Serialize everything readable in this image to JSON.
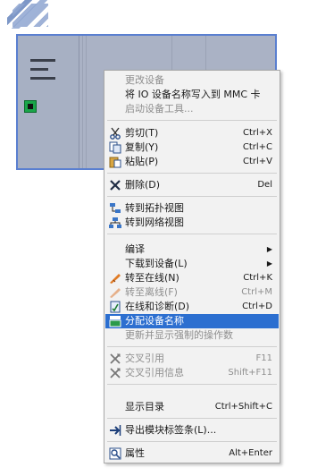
{
  "menu": {
    "items": [
      {
        "label": "更改设备",
        "shortcut": "",
        "icon": "",
        "enabled": false,
        "selected": false,
        "submenu": false
      },
      {
        "label": "将 IO 设备名称写入到 MMC 卡",
        "shortcut": "",
        "icon": "",
        "enabled": true,
        "selected": false,
        "submenu": false
      },
      {
        "label": "启动设备工具...",
        "shortcut": "",
        "icon": "",
        "enabled": false,
        "selected": false,
        "submenu": false
      },
      {
        "label": "剪切(T)",
        "shortcut": "Ctrl+X",
        "icon": "scissors-icon",
        "enabled": true,
        "selected": false,
        "submenu": false
      },
      {
        "label": "复制(Y)",
        "shortcut": "Ctrl+C",
        "icon": "copy-icon",
        "enabled": true,
        "selected": false,
        "submenu": false
      },
      {
        "label": "粘贴(P)",
        "shortcut": "Ctrl+V",
        "icon": "paste-icon",
        "enabled": true,
        "selected": false,
        "submenu": false
      },
      {
        "label": "删除(D)",
        "shortcut": "Del",
        "icon": "delete-x-icon",
        "enabled": true,
        "selected": false,
        "submenu": false
      },
      {
        "label": "转到拓扑视图",
        "shortcut": "",
        "icon": "topology-view-icon",
        "enabled": true,
        "selected": false,
        "submenu": false
      },
      {
        "label": "转到网络视图",
        "shortcut": "",
        "icon": "network-view-icon",
        "enabled": true,
        "selected": false,
        "submenu": false
      },
      {
        "label": "编译",
        "shortcut": "",
        "icon": "",
        "enabled": true,
        "selected": false,
        "submenu": true
      },
      {
        "label": "下载到设备(L)",
        "shortcut": "",
        "icon": "",
        "enabled": true,
        "selected": false,
        "submenu": true
      },
      {
        "label": "转至在线(N)",
        "shortcut": "Ctrl+K",
        "icon": "go-online-icon",
        "enabled": true,
        "selected": false,
        "submenu": false
      },
      {
        "label": "转至离线(F)",
        "shortcut": "Ctrl+M",
        "icon": "go-offline-icon",
        "enabled": false,
        "selected": false,
        "submenu": false
      },
      {
        "label": "在线和诊断(D)",
        "shortcut": "Ctrl+D",
        "icon": "diagnostics-icon",
        "enabled": true,
        "selected": false,
        "submenu": false
      },
      {
        "label": "分配设备名称",
        "shortcut": "",
        "icon": "assign-name-icon",
        "enabled": true,
        "selected": true,
        "submenu": false
      },
      {
        "label": "更新并显示强制的操作数",
        "shortcut": "",
        "icon": "",
        "enabled": false,
        "selected": false,
        "submenu": false
      },
      {
        "label": "交叉引用",
        "shortcut": "F11",
        "icon": "cross-reference-icon",
        "enabled": false,
        "selected": false,
        "submenu": false
      },
      {
        "label": "交叉引用信息",
        "shortcut": "Shift+F11",
        "icon": "cross-reference-info-icon",
        "enabled": false,
        "selected": false,
        "submenu": false
      },
      {
        "label": "显示目录",
        "shortcut": "Ctrl+Shift+C",
        "icon": "",
        "enabled": true,
        "selected": false,
        "submenu": false
      },
      {
        "label": "导出模块标签条(L)...",
        "shortcut": "",
        "icon": "export-arrow-icon",
        "enabled": true,
        "selected": false,
        "submenu": false
      },
      {
        "label": "属性",
        "shortcut": "Alt+Enter",
        "icon": "properties-icon",
        "enabled": true,
        "selected": false,
        "submenu": false
      }
    ]
  },
  "colors": {
    "selection": "#2c6fd0",
    "device_border": "#5a7fd0",
    "device_body": "#aab2c5",
    "port": "#1aa64a"
  }
}
